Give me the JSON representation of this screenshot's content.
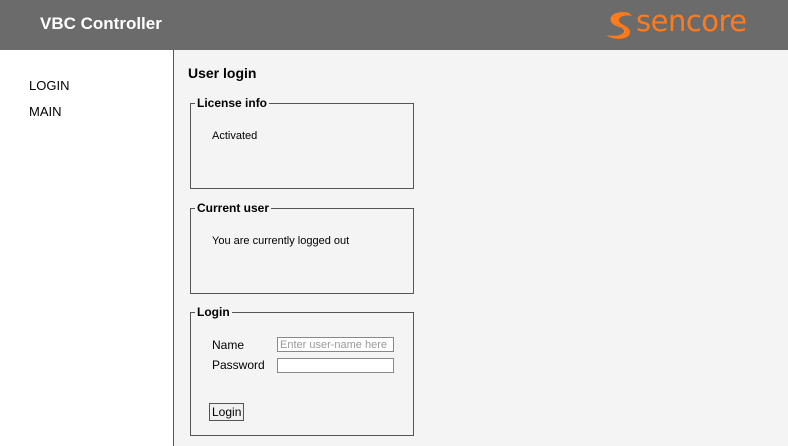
{
  "header": {
    "title": "VBC Controller",
    "logo_text": "sencore",
    "logo_color": "#ff7a1a"
  },
  "sidebar": {
    "items": [
      {
        "label": "LOGIN"
      },
      {
        "label": "MAIN"
      }
    ]
  },
  "main": {
    "title": "User login",
    "license": {
      "legend": "License info",
      "status": "Activated"
    },
    "current_user": {
      "legend": "Current user",
      "status": "You are currently logged out"
    },
    "login": {
      "legend": "Login",
      "name_label": "Name",
      "name_placeholder": "Enter user-name here",
      "name_value": "",
      "password_label": "Password",
      "password_value": "",
      "button_label": "Login"
    }
  }
}
